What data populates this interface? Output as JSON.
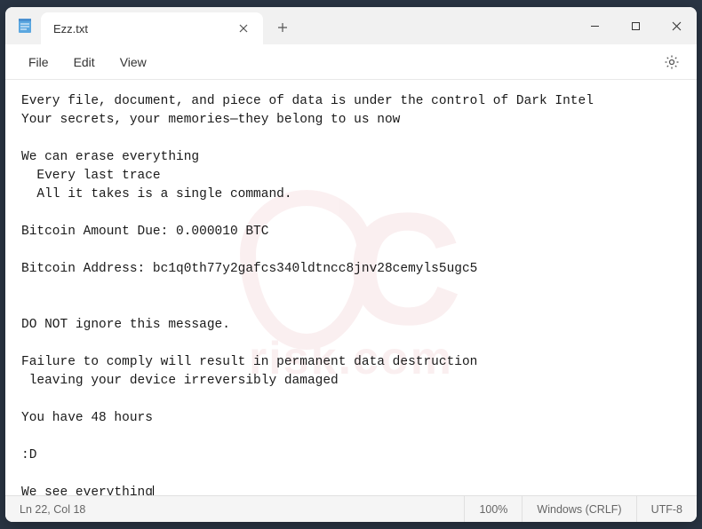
{
  "tab": {
    "title": "Ezz.txt"
  },
  "menu": {
    "file": "File",
    "edit": "Edit",
    "view": "View"
  },
  "content": {
    "text": "Every file, document, and piece of data is under the control of Dark Intel\nYour secrets, your memories—they belong to us now\n\nWe can erase everything\n  Every last trace\n  All it takes is a single command.\n\nBitcoin Amount Due: 0.000010 BTC\n\nBitcoin Address: bc1q0th77y2gafcs340ldtncc8jnv28cemyls5ugc5\n\n\nDO NOT ignore this message.\n\nFailure to comply will result in permanent data destruction\n leaving your device irreversibly damaged\n\nYou have 48 hours\n\n:D\n\nWe see everything"
  },
  "statusbar": {
    "position": "Ln 22, Col 18",
    "zoom": "100%",
    "encoding_line": "Windows (CRLF)",
    "encoding_char": "UTF-8"
  },
  "watermark": {
    "text": "risk.com"
  }
}
